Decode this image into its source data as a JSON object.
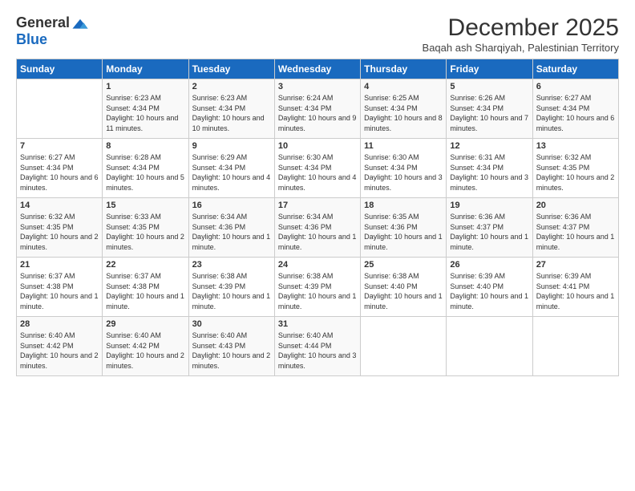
{
  "header": {
    "logo_general": "General",
    "logo_blue": "Blue",
    "month_year": "December 2025",
    "location": "Baqah ash Sharqiyah, Palestinian Territory"
  },
  "days_of_week": [
    "Sunday",
    "Monday",
    "Tuesday",
    "Wednesday",
    "Thursday",
    "Friday",
    "Saturday"
  ],
  "weeks": [
    [
      null,
      {
        "day": 1,
        "sunrise": "6:23 AM",
        "sunset": "4:34 PM",
        "daylight": "10 hours and 11 minutes."
      },
      {
        "day": 2,
        "sunrise": "6:23 AM",
        "sunset": "4:34 PM",
        "daylight": "10 hours and 10 minutes."
      },
      {
        "day": 3,
        "sunrise": "6:24 AM",
        "sunset": "4:34 PM",
        "daylight": "10 hours and 9 minutes."
      },
      {
        "day": 4,
        "sunrise": "6:25 AM",
        "sunset": "4:34 PM",
        "daylight": "10 hours and 8 minutes."
      },
      {
        "day": 5,
        "sunrise": "6:26 AM",
        "sunset": "4:34 PM",
        "daylight": "10 hours and 7 minutes."
      },
      {
        "day": 6,
        "sunrise": "6:27 AM",
        "sunset": "4:34 PM",
        "daylight": "10 hours and 6 minutes."
      }
    ],
    [
      {
        "day": 7,
        "sunrise": "6:27 AM",
        "sunset": "4:34 PM",
        "daylight": "10 hours and 6 minutes."
      },
      {
        "day": 8,
        "sunrise": "6:28 AM",
        "sunset": "4:34 PM",
        "daylight": "10 hours and 5 minutes."
      },
      {
        "day": 9,
        "sunrise": "6:29 AM",
        "sunset": "4:34 PM",
        "daylight": "10 hours and 4 minutes."
      },
      {
        "day": 10,
        "sunrise": "6:30 AM",
        "sunset": "4:34 PM",
        "daylight": "10 hours and 4 minutes."
      },
      {
        "day": 11,
        "sunrise": "6:30 AM",
        "sunset": "4:34 PM",
        "daylight": "10 hours and 3 minutes."
      },
      {
        "day": 12,
        "sunrise": "6:31 AM",
        "sunset": "4:34 PM",
        "daylight": "10 hours and 3 minutes."
      },
      {
        "day": 13,
        "sunrise": "6:32 AM",
        "sunset": "4:35 PM",
        "daylight": "10 hours and 2 minutes."
      }
    ],
    [
      {
        "day": 14,
        "sunrise": "6:32 AM",
        "sunset": "4:35 PM",
        "daylight": "10 hours and 2 minutes."
      },
      {
        "day": 15,
        "sunrise": "6:33 AM",
        "sunset": "4:35 PM",
        "daylight": "10 hours and 2 minutes."
      },
      {
        "day": 16,
        "sunrise": "6:34 AM",
        "sunset": "4:36 PM",
        "daylight": "10 hours and 1 minute."
      },
      {
        "day": 17,
        "sunrise": "6:34 AM",
        "sunset": "4:36 PM",
        "daylight": "10 hours and 1 minute."
      },
      {
        "day": 18,
        "sunrise": "6:35 AM",
        "sunset": "4:36 PM",
        "daylight": "10 hours and 1 minute."
      },
      {
        "day": 19,
        "sunrise": "6:36 AM",
        "sunset": "4:37 PM",
        "daylight": "10 hours and 1 minute."
      },
      {
        "day": 20,
        "sunrise": "6:36 AM",
        "sunset": "4:37 PM",
        "daylight": "10 hours and 1 minute."
      }
    ],
    [
      {
        "day": 21,
        "sunrise": "6:37 AM",
        "sunset": "4:38 PM",
        "daylight": "10 hours and 1 minute."
      },
      {
        "day": 22,
        "sunrise": "6:37 AM",
        "sunset": "4:38 PM",
        "daylight": "10 hours and 1 minute."
      },
      {
        "day": 23,
        "sunrise": "6:38 AM",
        "sunset": "4:39 PM",
        "daylight": "10 hours and 1 minute."
      },
      {
        "day": 24,
        "sunrise": "6:38 AM",
        "sunset": "4:39 PM",
        "daylight": "10 hours and 1 minute."
      },
      {
        "day": 25,
        "sunrise": "6:38 AM",
        "sunset": "4:40 PM",
        "daylight": "10 hours and 1 minute."
      },
      {
        "day": 26,
        "sunrise": "6:39 AM",
        "sunset": "4:40 PM",
        "daylight": "10 hours and 1 minute."
      },
      {
        "day": 27,
        "sunrise": "6:39 AM",
        "sunset": "4:41 PM",
        "daylight": "10 hours and 1 minute."
      }
    ],
    [
      {
        "day": 28,
        "sunrise": "6:40 AM",
        "sunset": "4:42 PM",
        "daylight": "10 hours and 2 minutes."
      },
      {
        "day": 29,
        "sunrise": "6:40 AM",
        "sunset": "4:42 PM",
        "daylight": "10 hours and 2 minutes."
      },
      {
        "day": 30,
        "sunrise": "6:40 AM",
        "sunset": "4:43 PM",
        "daylight": "10 hours and 2 minutes."
      },
      {
        "day": 31,
        "sunrise": "6:40 AM",
        "sunset": "4:44 PM",
        "daylight": "10 hours and 3 minutes."
      },
      null,
      null,
      null
    ]
  ],
  "labels": {
    "sunrise": "Sunrise:",
    "sunset": "Sunset:",
    "daylight": "Daylight:"
  }
}
